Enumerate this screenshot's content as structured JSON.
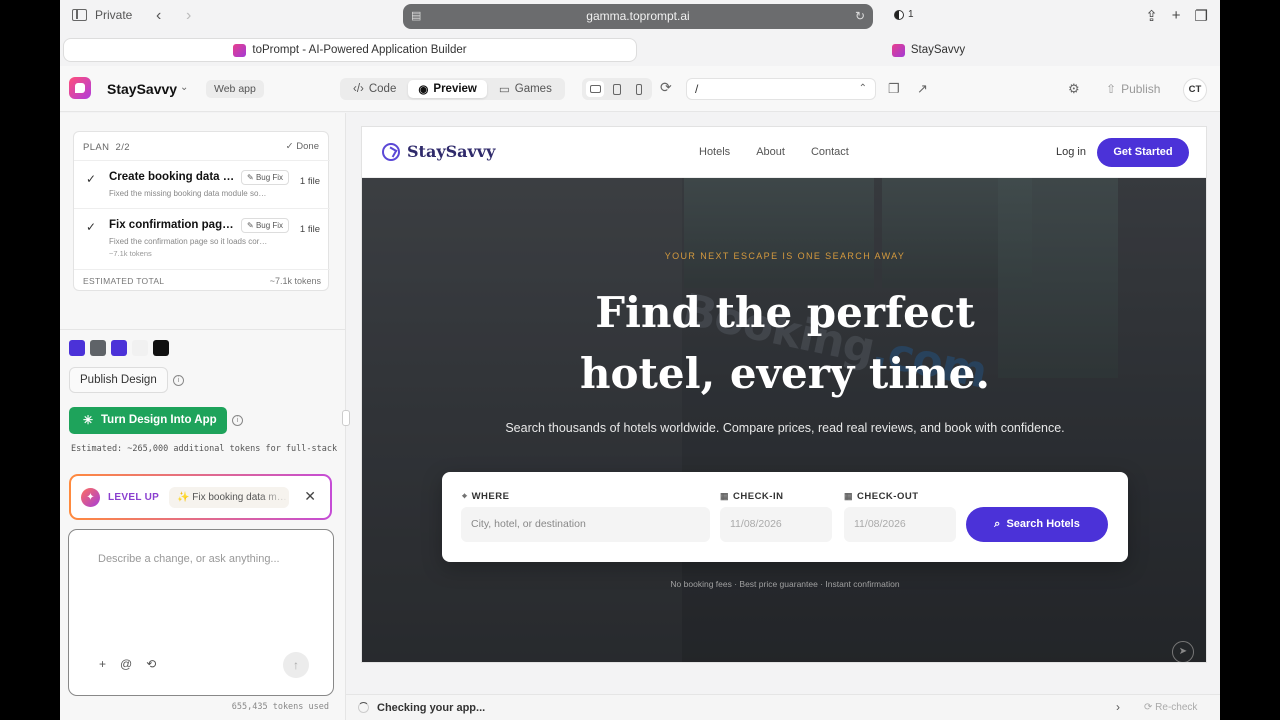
{
  "browser": {
    "private_label": "Private",
    "address": "gamma.toprompt.ai",
    "shield_count": "1",
    "tabs": [
      {
        "label": "toPrompt - AI-Powered Application Builder"
      },
      {
        "label": "StaySavvy"
      }
    ]
  },
  "appbar": {
    "app_name": "StaySavvy",
    "badge": "Web app",
    "modes": [
      {
        "label": "Code",
        "icon": "code-icon"
      },
      {
        "label": "Preview",
        "icon": "eye-icon",
        "active": true
      },
      {
        "label": "Games",
        "icon": "gamepad-icon"
      }
    ],
    "path": "/",
    "publish_label": "Publish",
    "avatar_initials": "CT"
  },
  "plan": {
    "header": "PLAN",
    "progress": "2/2",
    "status": "Done",
    "items": [
      {
        "title": "Create booking data u…",
        "tag": "Bug Fix",
        "files": "1 file",
        "desc": "Fixed the missing booking data module so…",
        "sub": ""
      },
      {
        "title": "Fix confirmation page…",
        "tag": "Bug Fix",
        "files": "1 file",
        "desc": "Fixed the confirmation page so it loads cor…",
        "sub": "~7.1k tokens"
      }
    ],
    "total_label": "ESTIMATED TOTAL",
    "total_value": "~7.1k tokens"
  },
  "design": {
    "swatches": [
      "#4b32d8",
      "#5f6368",
      "#4b32d8",
      "#f1f1f1",
      "#111111"
    ],
    "publish_label": "Publish Design",
    "turn_label": "Turn Design Into App",
    "estimated": "Estimated: ~265,000 additional tokens for full-stack"
  },
  "levelup": {
    "label": "LEVEL UP",
    "chip": "Fix booking data m…"
  },
  "composer": {
    "placeholder": "Describe a change, or ask anything...",
    "tokens_used": "655,435 tokens used"
  },
  "site": {
    "brand": "StaySavvy",
    "nav_links": [
      "Hotels",
      "About",
      "Contact"
    ],
    "login": "Log in",
    "cta": "Get Started",
    "eyebrow": "YOUR NEXT ESCAPE IS ONE SEARCH AWAY",
    "title_line1": "Find the perfect",
    "title_line2": "hotel, every time.",
    "subtitle": "Search thousands of hotels worldwide. Compare prices, read real reviews, and book with confidence.",
    "search": {
      "where_label": "WHERE",
      "where_placeholder": "City, hotel, or destination",
      "checkin_label": "CHECK-IN",
      "checkin_value": "11/08/2026",
      "checkout_label": "CHECK-OUT",
      "checkout_value": "11/08/2026",
      "button": "Search Hotels"
    },
    "footnote": "No booking fees · Best price guarantee · Instant confirmation",
    "sign_text": "Booking",
    "sign_suffix": ".com"
  },
  "status": {
    "text": "Checking your app...",
    "recheck": "Re-check"
  }
}
